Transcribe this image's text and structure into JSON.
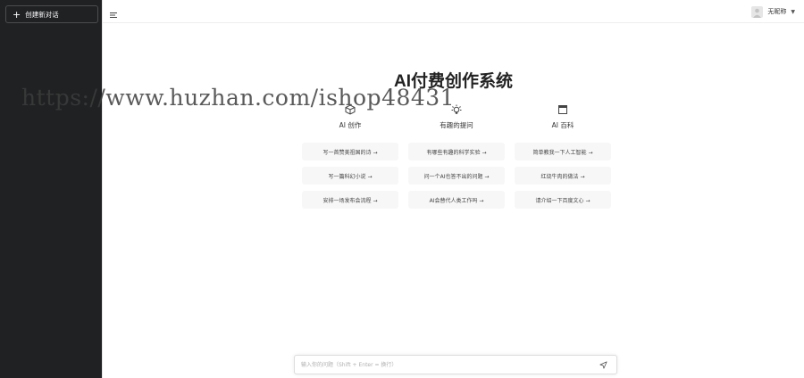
{
  "sidebar": {
    "new_chat_label": "创建新对话"
  },
  "topbar": {
    "username": "无昵称"
  },
  "main": {
    "title": "AI付费创作系统",
    "columns": [
      {
        "title": "AI 创作",
        "icon": "cube-icon",
        "prompts": [
          "写一首赞美祖国的诗 →",
          "写一篇科幻小说 →",
          "安排一场发布会流程 →"
        ]
      },
      {
        "title": "有趣的提问",
        "icon": "lightbulb-icon",
        "prompts": [
          "有哪些有趣的科学实验 →",
          "问一个AI也答不出的问题 →",
          "AI会替代人类工作吗 →"
        ]
      },
      {
        "title": "AI 百科",
        "icon": "book-icon",
        "prompts": [
          "简单教我一下人工智能 →",
          "红烧牛肉的做法 →",
          "请介绍一下百度文心 →"
        ]
      }
    ]
  },
  "input": {
    "placeholder": "输入你的问题（Shift + Enter = 换行）"
  },
  "watermark": "https://www.huzhan.com/ishop48431",
  "colors": {
    "sidebar_bg": "#202123",
    "card_bg": "#f7f7f8"
  }
}
